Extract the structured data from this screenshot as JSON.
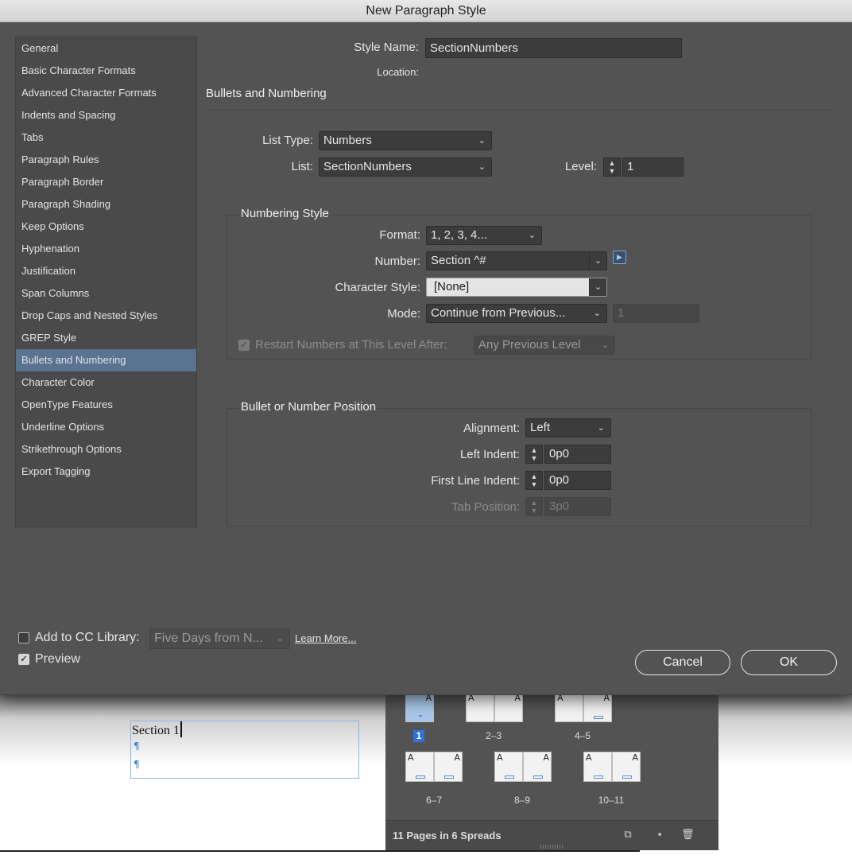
{
  "dialog": {
    "title": "New Paragraph Style",
    "sidebar": {
      "items": [
        {
          "label": "General"
        },
        {
          "label": "Basic Character Formats"
        },
        {
          "label": "Advanced Character Formats"
        },
        {
          "label": "Indents and Spacing"
        },
        {
          "label": "Tabs"
        },
        {
          "label": "Paragraph Rules"
        },
        {
          "label": "Paragraph Border"
        },
        {
          "label": "Paragraph Shading"
        },
        {
          "label": "Keep Options"
        },
        {
          "label": "Hyphenation"
        },
        {
          "label": "Justification"
        },
        {
          "label": "Span Columns"
        },
        {
          "label": "Drop Caps and Nested Styles"
        },
        {
          "label": "GREP Style"
        },
        {
          "label": "Bullets and Numbering"
        },
        {
          "label": "Character Color"
        },
        {
          "label": "OpenType Features"
        },
        {
          "label": "Underline Options"
        },
        {
          "label": "Strikethrough Options"
        },
        {
          "label": "Export Tagging"
        }
      ],
      "selected": "Bullets and Numbering"
    },
    "style_name": {
      "label": "Style Name:",
      "value": "SectionNumbers"
    },
    "location_label": "Location:",
    "section_title": "Bullets and Numbering",
    "list_type": {
      "label": "List Type:",
      "value": "Numbers"
    },
    "list": {
      "label": "List:",
      "value": "SectionNumbers"
    },
    "level": {
      "label": "Level:",
      "value": "1"
    },
    "numbering_style": {
      "title": "Numbering Style",
      "format": {
        "label": "Format:",
        "value": "1, 2, 3, 4..."
      },
      "number": {
        "label": "Number:",
        "value": "Section ^#"
      },
      "character_style": {
        "label": "Character Style:",
        "value": "[None]"
      },
      "mode": {
        "label": "Mode:",
        "value": "Continue from Previous...",
        "start_value": "1"
      },
      "restart": {
        "label": "Restart Numbers at This Level After:",
        "value": "Any Previous Level",
        "checked": true,
        "enabled": false
      }
    },
    "position": {
      "title": "Bullet or Number Position",
      "alignment": {
        "label": "Alignment:",
        "value": "Left"
      },
      "left_indent": {
        "label": "Left Indent:",
        "value": "0p0"
      },
      "first_line_indent": {
        "label": "First Line Indent:",
        "value": "0p0"
      },
      "tab_position": {
        "label": "Tab Position:",
        "value": "3p0",
        "enabled": false
      }
    },
    "cc_library": {
      "label": "Add to CC Library:",
      "checked": false,
      "value": "Five Days from N...",
      "learn_more": "Learn More..."
    },
    "preview": {
      "label": "Preview",
      "checked": true
    },
    "buttons": {
      "cancel": "Cancel",
      "ok": "OK"
    }
  },
  "document": {
    "frame_text": "Section 1",
    "pilcrow": "¶"
  },
  "pages_panel": {
    "spreads": [
      {
        "label": "1",
        "selected": true
      },
      {
        "label": "2–3"
      },
      {
        "label": "4–5"
      },
      {
        "label": "6–7"
      },
      {
        "label": "8–9"
      },
      {
        "label": "10–11"
      }
    ],
    "master_marker": "A",
    "status": "11 Pages in 6 Spreads"
  }
}
